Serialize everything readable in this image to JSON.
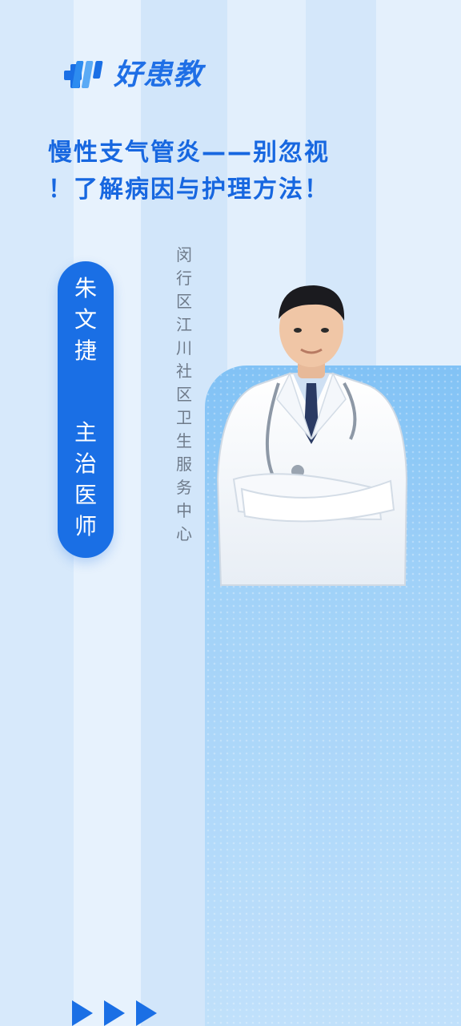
{
  "brand": {
    "name": "好患教"
  },
  "article": {
    "title_line1": "慢性支气管炎——别忽视",
    "title_line2": "！了解病因与护理方法！"
  },
  "doctor": {
    "name": "朱文捷",
    "title": "主治医师",
    "institution": "闵行区江川社区卫生服务中心"
  },
  "colors": {
    "accent": "#1a6fe5",
    "title": "#1767e0"
  },
  "icons": [
    "logo-cross-icon",
    "doctor-portrait",
    "play-arrow-icon"
  ]
}
